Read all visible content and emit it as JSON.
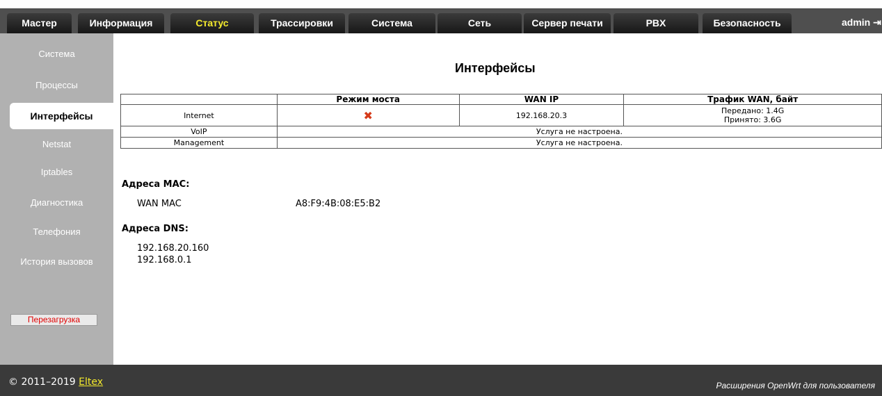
{
  "header": {
    "tabs": [
      {
        "label": "Мастер",
        "active": false
      },
      {
        "label": "Информация",
        "active": false
      },
      {
        "label": "Статус",
        "active": true
      },
      {
        "label": "Трассировки",
        "active": false
      },
      {
        "label": "Система",
        "active": false
      },
      {
        "label": "Сеть",
        "active": false
      },
      {
        "label": "Сервер печати",
        "active": false
      },
      {
        "label": "PBX",
        "active": false
      },
      {
        "label": "Безопасность",
        "active": false
      }
    ],
    "user": "admin",
    "active_tab_color": "#f4ea2c"
  },
  "sidebar": {
    "items": [
      {
        "label": "Система",
        "active": false
      },
      {
        "label": "Процессы",
        "active": false
      },
      {
        "label": "Интерфейсы",
        "active": true
      },
      {
        "label": "Netstat",
        "active": false
      },
      {
        "label": "Iptables",
        "active": false
      },
      {
        "label": "Диагностика",
        "active": false
      },
      {
        "label": "Телефония",
        "active": false
      },
      {
        "label": "История вызовов",
        "active": false
      }
    ],
    "reboot_label": "Перезагрузка",
    "reboot_color": "#e00000"
  },
  "main": {
    "title": "Интерфейсы",
    "table": {
      "headers": [
        "",
        "Режим моста",
        "WAN IP",
        "Трафик WAN, байт"
      ],
      "internet": {
        "name": "Internet",
        "bridge_icon": "x-mark-icon",
        "wan_ip": "192.168.20.3",
        "sent": "Передано: 1.4G",
        "received": "Принято: 3.6G"
      },
      "voip": {
        "name": "VoIP",
        "status": "Услуга не настроена."
      },
      "management": {
        "name": "Management",
        "status": "Услуга не настроена."
      }
    },
    "mac": {
      "title": "Адреса MAC:",
      "label": "WAN MAC",
      "value": "A8:F9:4B:08:E5:B2"
    },
    "dns": {
      "title": "Адреса DNS:",
      "servers": [
        "192.168.20.160",
        "192.168.0.1"
      ]
    }
  },
  "footer": {
    "copyright": "© 2011–2019 ",
    "brand": "Eltex",
    "extension": "Расширения OpenWrt для пользователя"
  }
}
